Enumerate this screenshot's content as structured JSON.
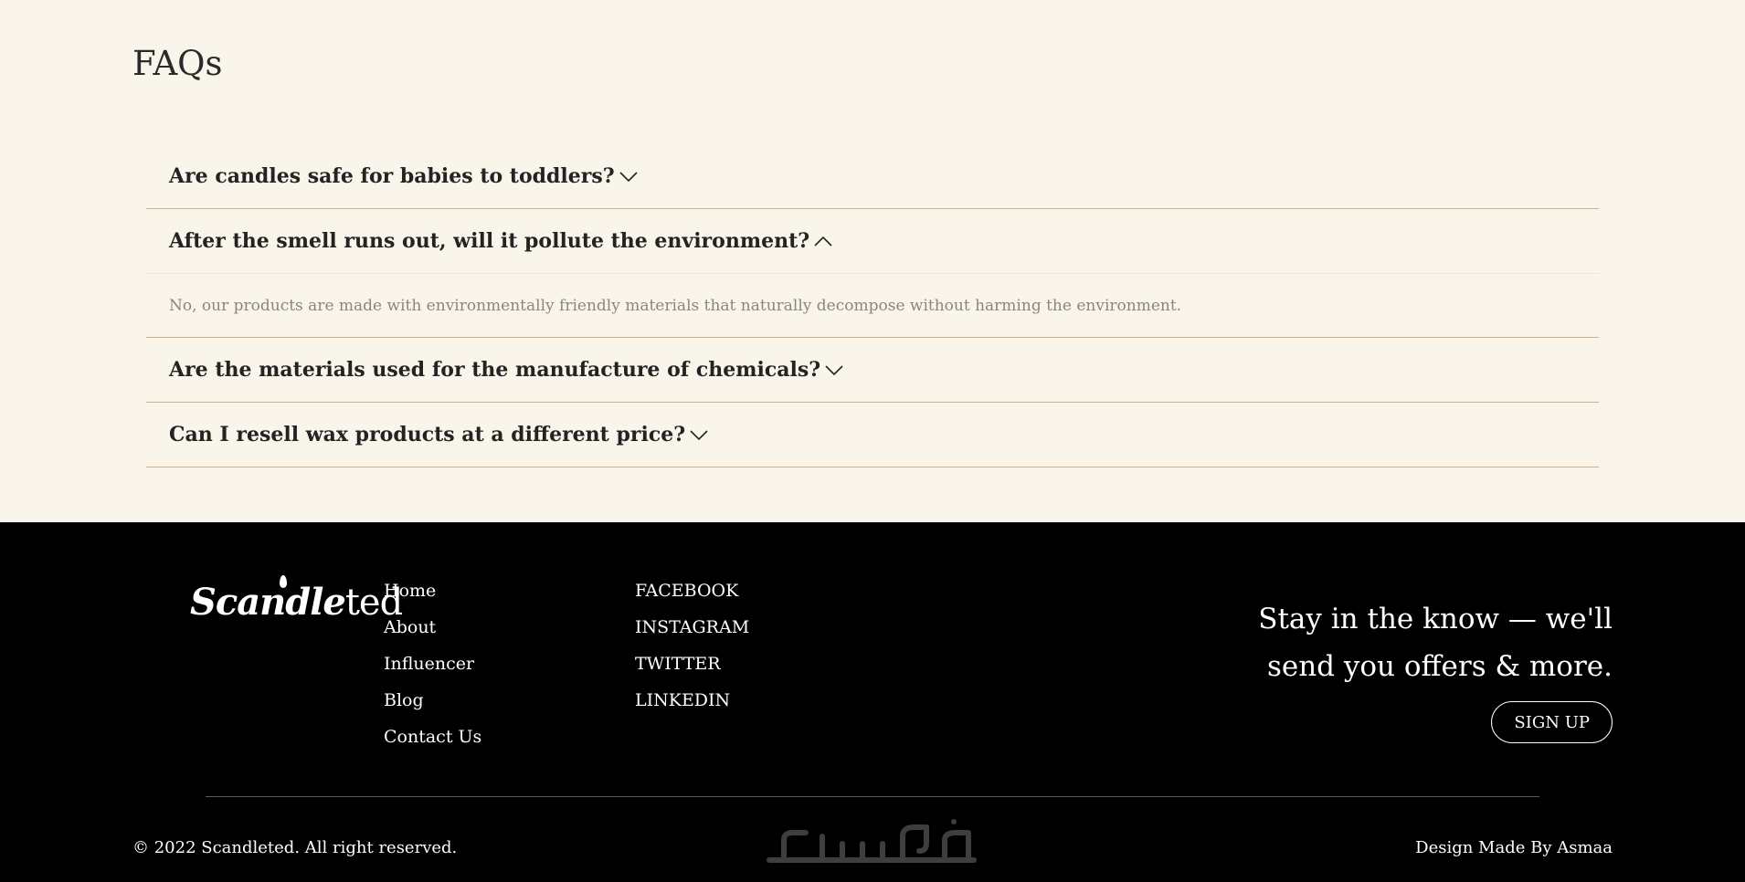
{
  "faq": {
    "title": "FAQs",
    "items": [
      {
        "question": "Are candles safe for babies to toddlers?",
        "expanded": false,
        "answer": ""
      },
      {
        "question": "After the smell runs out, will it pollute the environment?",
        "expanded": true,
        "answer": "No, our products are made with environmentally friendly materials that naturally decompose without harming the environment."
      },
      {
        "question": "Are the materials used for the manufacture of chemicals?",
        "expanded": false,
        "answer": ""
      },
      {
        "question": "Can I resell wax products at a different price?",
        "expanded": false,
        "answer": ""
      }
    ]
  },
  "footer": {
    "logo_text_bold": "Scandle",
    "logo_text_light": "ted",
    "pages": [
      "Home",
      "About",
      "Influencer",
      "Blog",
      "Contact Us"
    ],
    "social": [
      "FACEBOOK",
      "INSTAGRAM",
      "TWITTER",
      "LINKEDIN"
    ],
    "newsletter_line1": "Stay in the know — we'll",
    "newsletter_line2": "send you offers & more.",
    "signup_label": "SIGN UP",
    "copyright": "© 2022 Scandleted. All right reserved.",
    "credit": "Design Made By Asmaa",
    "watermark_text": "خمسات"
  },
  "colors": {
    "page_bg": "#faf5eb",
    "footer_bg": "#000000",
    "divider": "#d2b190",
    "answer_text": "#8a8580"
  },
  "icons": {
    "collapsed": "chevron-down-icon",
    "expanded": "chevron-up-icon"
  }
}
